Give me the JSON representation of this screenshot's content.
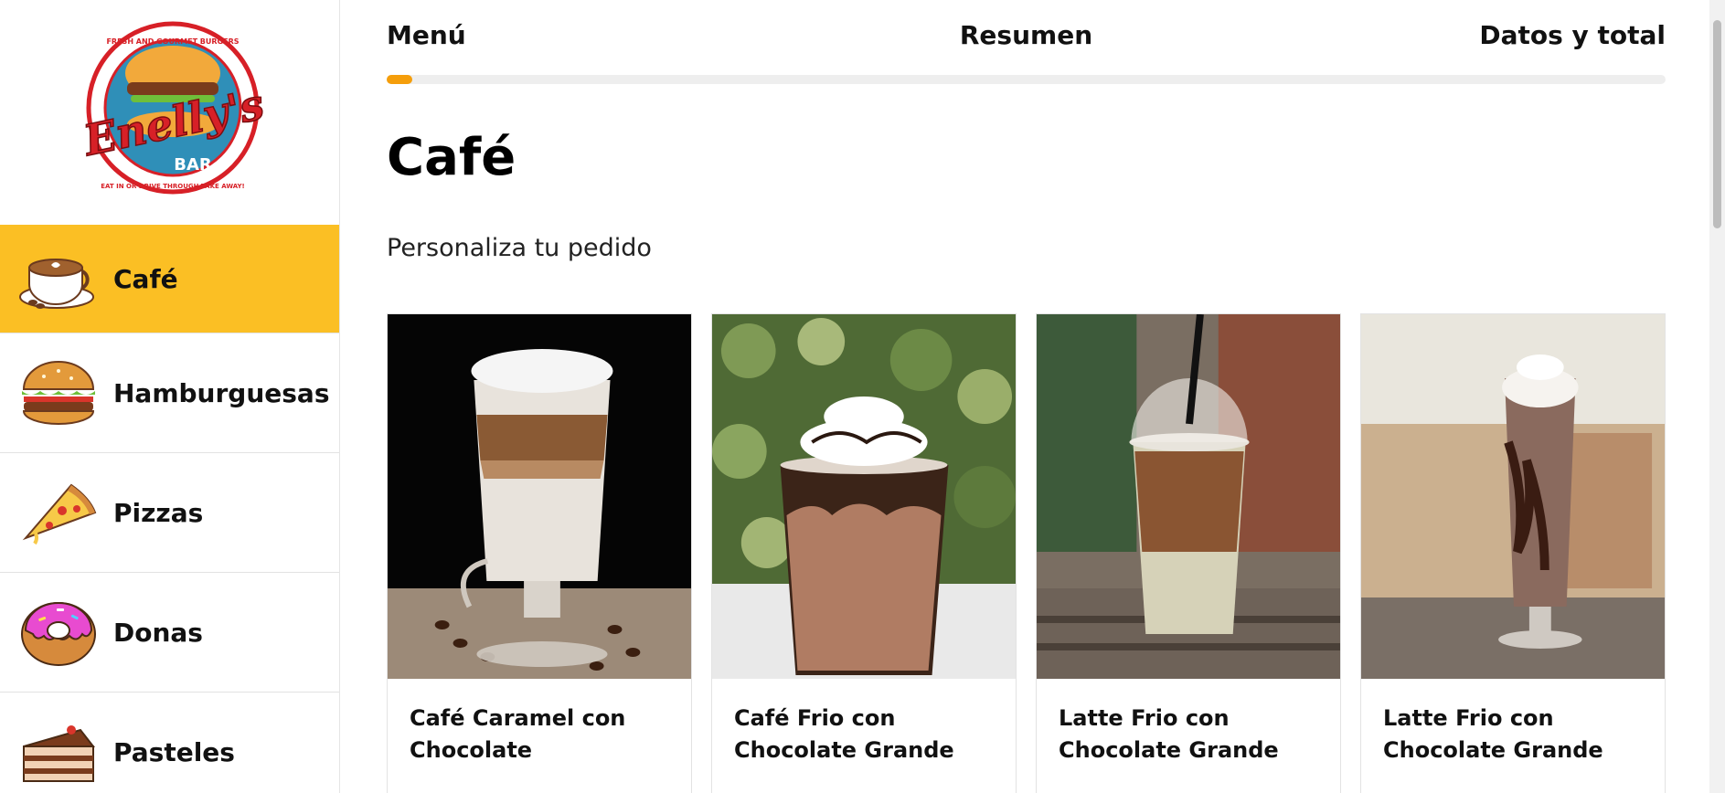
{
  "brand": {
    "logo_text_main": "Enelly's",
    "logo_text_bar": "BAR",
    "logo_text_top": "FRESH AND GOURMET BURGERS",
    "logo_text_bottom": "EAT IN OR DRIVE THROUGH TAKE AWAY!"
  },
  "sidebar": {
    "items": [
      {
        "label": "Café",
        "icon": "coffee-cup-icon",
        "active": true
      },
      {
        "label": "Hamburguesas",
        "icon": "burger-icon",
        "active": false
      },
      {
        "label": "Pizzas",
        "icon": "pizza-slice-icon",
        "active": false
      },
      {
        "label": "Donas",
        "icon": "donut-icon",
        "active": false
      },
      {
        "label": "Pasteles",
        "icon": "cake-slice-icon",
        "active": false
      }
    ]
  },
  "steps": {
    "items": [
      "Menú",
      "Resumen",
      "Datos y total"
    ],
    "progress": 0.02
  },
  "main": {
    "title": "Café",
    "subtitle": "Personaliza tu pedido"
  },
  "products": [
    {
      "name": "Café Caramel con Chocolate"
    },
    {
      "name": "Café Frio con Chocolate Grande"
    },
    {
      "name": "Latte Frio con Chocolate Grande"
    },
    {
      "name": "Latte Frio con Chocolate Grande"
    }
  ],
  "colors": {
    "accent": "#fbbf24",
    "progress": "#f59e0b",
    "logo_red": "#d72027",
    "logo_blue": "#2f8fb8"
  }
}
